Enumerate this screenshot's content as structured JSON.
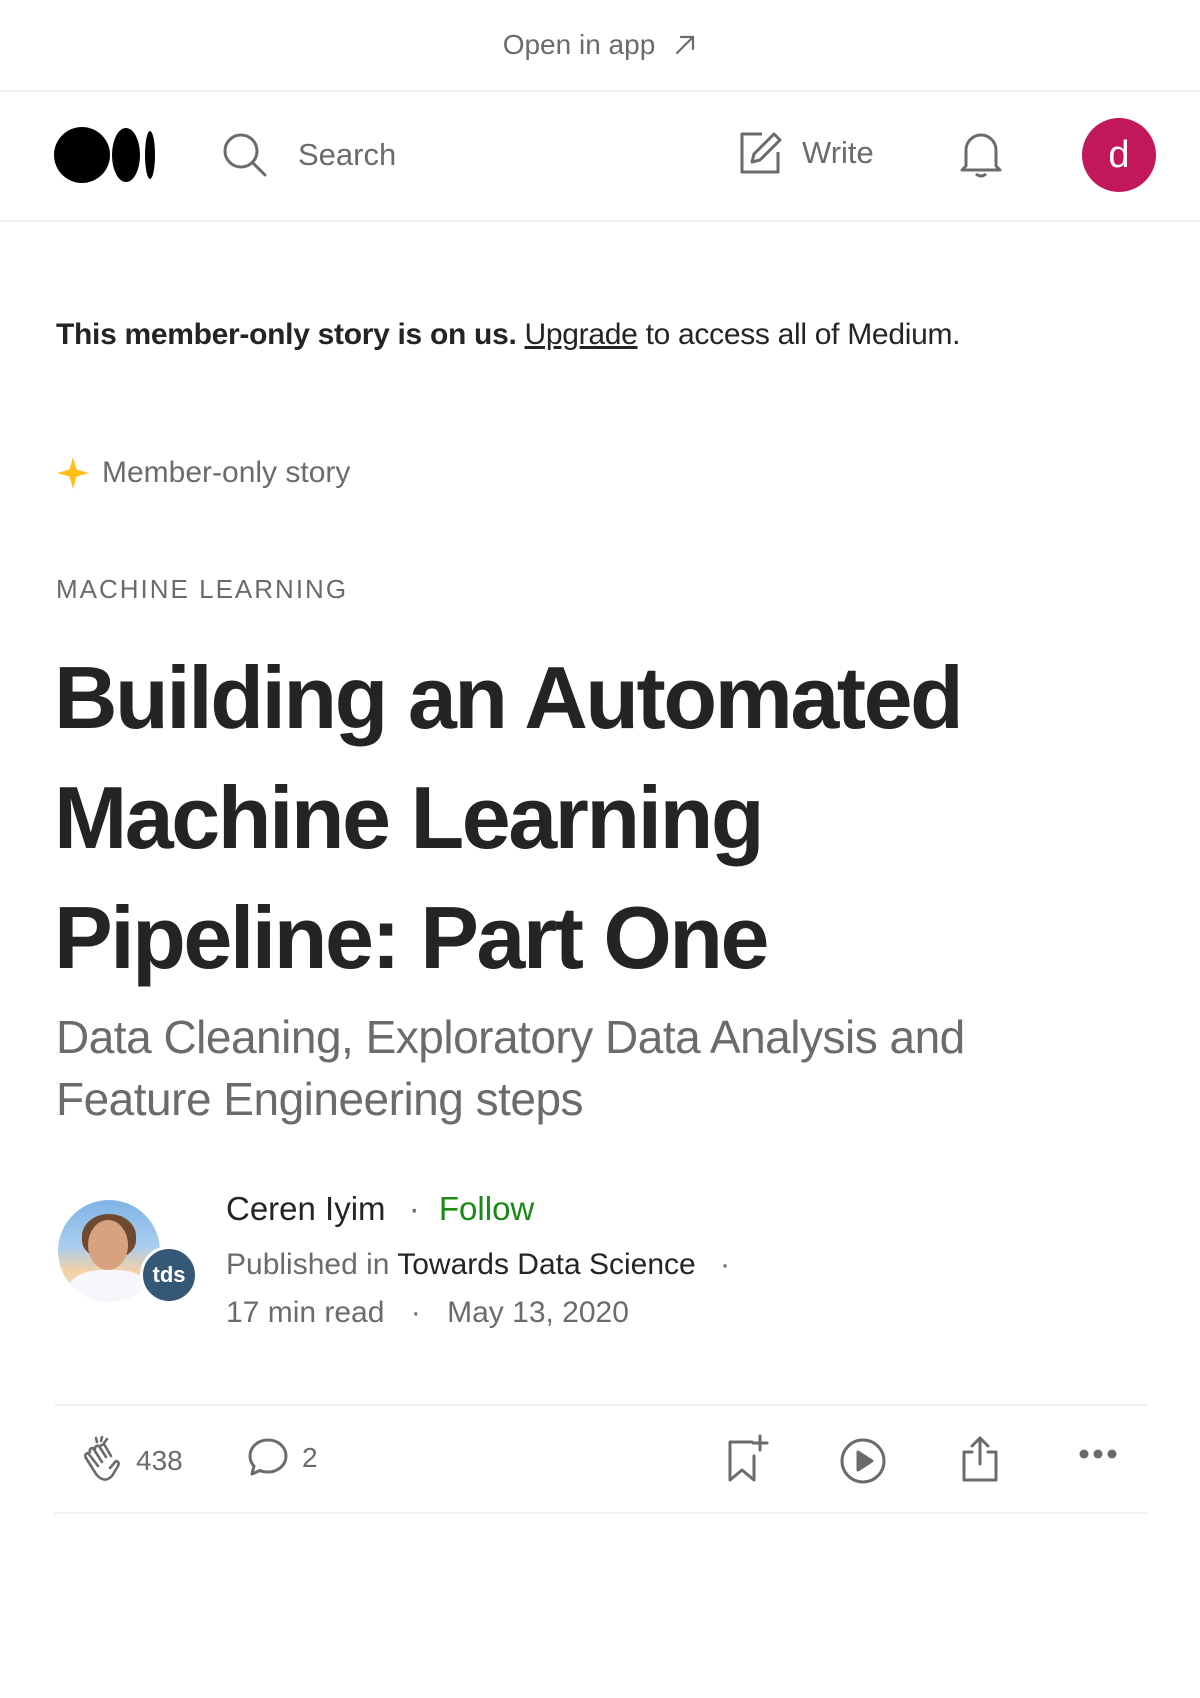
{
  "open_in_app": {
    "label": "Open in app"
  },
  "nav": {
    "search_label": "Search",
    "write_label": "Write",
    "user_initial": "d"
  },
  "banner": {
    "bold_text": "This member-only story is on us.",
    "link_text": "Upgrade",
    "rest_text": "to access all of Medium."
  },
  "member_only": {
    "label": "Member-only story"
  },
  "article": {
    "tag": "MACHINE LEARNING",
    "title_lines": [
      "Building an Automated",
      "Machine Learning",
      "Pipeline: Part One"
    ],
    "subtitle_lines": [
      "Data Cleaning, Exploratory Data Analysis and",
      "Feature Engineering steps"
    ]
  },
  "author": {
    "name": "Ceren Iyim",
    "separator": "·",
    "follow_label": "Follow",
    "published_in_label": "Published in",
    "publication": "Towards Data Science",
    "publication_badge": "tds",
    "read_time": "17 min read",
    "date": "May 13, 2020"
  },
  "actions": {
    "claps": "438",
    "responses": "2"
  },
  "colors": {
    "accent_green": "#1a8917",
    "avatar_bg": "#c2185b",
    "star": "#ffc017",
    "publication_badge_bg": "#355876"
  }
}
